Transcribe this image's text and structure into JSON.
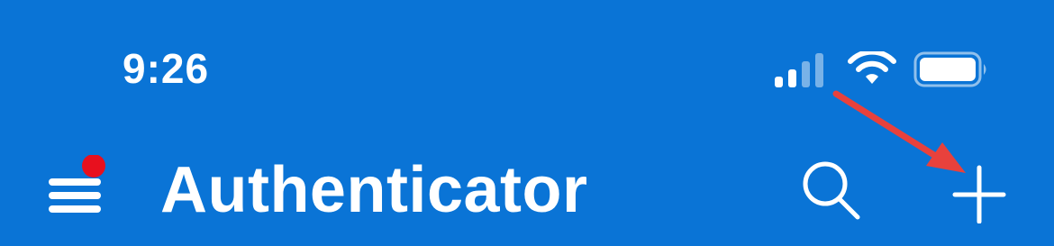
{
  "status_bar": {
    "time": "9:26",
    "signal_icon": "cellular-signal-icon",
    "wifi_icon": "wifi-icon",
    "battery_icon": "battery-icon"
  },
  "header": {
    "title": "Authenticator",
    "menu_icon": "hamburger-menu-icon",
    "has_notification_dot": true,
    "search_icon": "search-icon",
    "add_icon": "plus-icon"
  },
  "colors": {
    "background": "#0A74D6",
    "foreground": "#FFFFFF",
    "notification_dot": "#E8101E",
    "annotation_arrow": "#E8413C"
  },
  "annotation": {
    "type": "arrow",
    "target": "add-account-button"
  }
}
